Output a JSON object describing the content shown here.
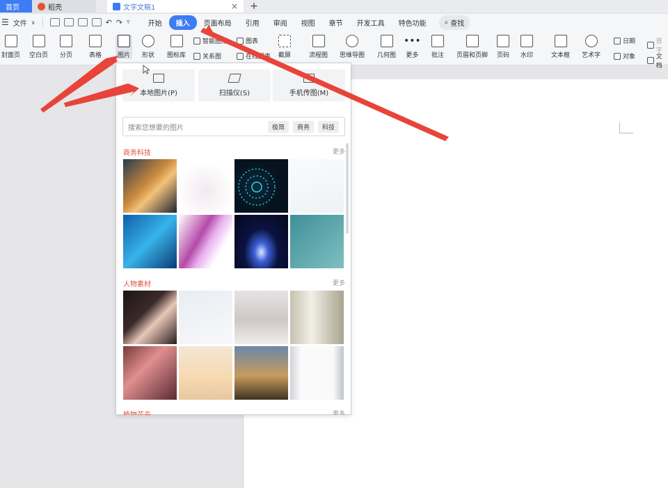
{
  "tabs": {
    "home": "首页",
    "daoke": "稻壳",
    "doc": "文字文稿1"
  },
  "menu": {
    "file": "文件",
    "tabs": [
      "开始",
      "插入",
      "页面布局",
      "引用",
      "审阅",
      "视图",
      "章节",
      "开发工具",
      "特色功能"
    ],
    "active_tab": "插入",
    "search": "查找"
  },
  "ribbon": {
    "cover": "封面页",
    "blank": "空白页",
    "pagebreak": "分页",
    "table": "表格",
    "picture": "图片",
    "shape": "形状",
    "iconlib": "图标库",
    "smart": "智能图形",
    "relation": "关系图",
    "chart": "图表",
    "online": "在线图表",
    "screenshot": "截屏",
    "flowchart": "流程图",
    "mindmap": "思维导图",
    "geometry": "几何图",
    "more": "更多",
    "comment": "批注",
    "header_footer": "页眉和页脚",
    "pagenum": "页码",
    "watermark": "水印",
    "textbox": "文本框",
    "wordart": "艺术字",
    "date": "日期",
    "object": "对象",
    "dropcap": "首字",
    "doc": "文档"
  },
  "panel": {
    "local": "本地图片(P)",
    "scanner": "扫描仪(S)",
    "phone": "手机传图(M)",
    "search_placeholder": "搜索您想要的图片",
    "tags": [
      "极简",
      "商务",
      "科技"
    ],
    "sections": [
      {
        "title": "商务科技",
        "more": "更多"
      },
      {
        "title": "人物素材",
        "more": "更多"
      },
      {
        "title": "植物花卉",
        "more": "更多"
      }
    ]
  },
  "colors": {
    "accent": "#3d7cf4",
    "section": "#e24f3b",
    "arrow": "#e8443a"
  }
}
